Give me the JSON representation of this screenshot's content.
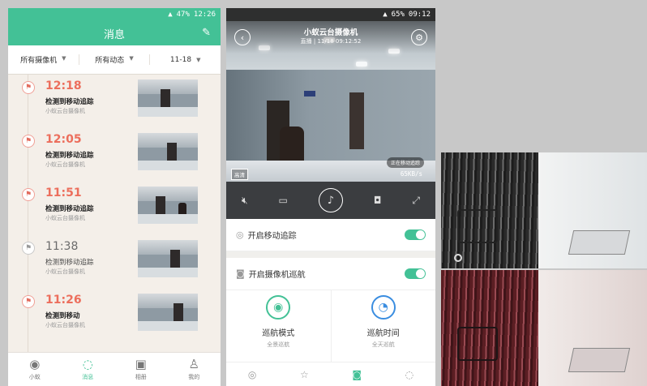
{
  "colors": {
    "accent": "#43c196",
    "event_red": "#ec6e5c",
    "blue": "#3a8de0"
  },
  "messages_screen": {
    "status_bar": {
      "battery": "47%",
      "time": "12:26"
    },
    "title": "消息",
    "filters": [
      {
        "label": "所有摄像机"
      },
      {
        "label": "所有动态"
      },
      {
        "label": "11-18"
      }
    ],
    "events": [
      {
        "time": "12:18",
        "title": "检测到移动追踪",
        "source": "小蚁云台摄像机",
        "read": false
      },
      {
        "time": "12:05",
        "title": "检测到移动追踪",
        "source": "小蚁云台摄像机",
        "read": false
      },
      {
        "time": "11:51",
        "title": "检测到移动追踪",
        "source": "小蚁云台摄像机",
        "read": false
      },
      {
        "time": "11:38",
        "title": "检测到移动追踪",
        "source": "小蚁云台摄像机",
        "read": true
      },
      {
        "time": "11:26",
        "title": "检测到移动",
        "source": "小蚁云台摄像机",
        "read": false
      }
    ],
    "tabs": [
      {
        "label": "小蚁",
        "icon": "camera-icon"
      },
      {
        "label": "消息",
        "icon": "message-icon",
        "active": true
      },
      {
        "label": "相册",
        "icon": "album-icon"
      },
      {
        "label": "我的",
        "icon": "profile-icon"
      }
    ]
  },
  "live_screen": {
    "status_bar": {
      "battery": "65%",
      "time": "09:12"
    },
    "camera_name": "小蚁云台摄像机",
    "live_text": "直播 | 11/18 09:12:52",
    "tracking_badge": "正在移动追踪",
    "quality": "高清",
    "bitrate": "65KB/s",
    "toggles": [
      {
        "label": "开启移动追踪",
        "on": true,
        "icon": "tracking-icon"
      },
      {
        "label": "开启摄像机巡航",
        "on": true,
        "icon": "cruise-icon"
      }
    ],
    "modes": [
      {
        "label": "巡航模式",
        "sub": "全景巡航",
        "icon": "location-pin-icon"
      },
      {
        "label": "巡航时间",
        "sub": "全天巡航",
        "icon": "clock-icon"
      }
    ]
  }
}
